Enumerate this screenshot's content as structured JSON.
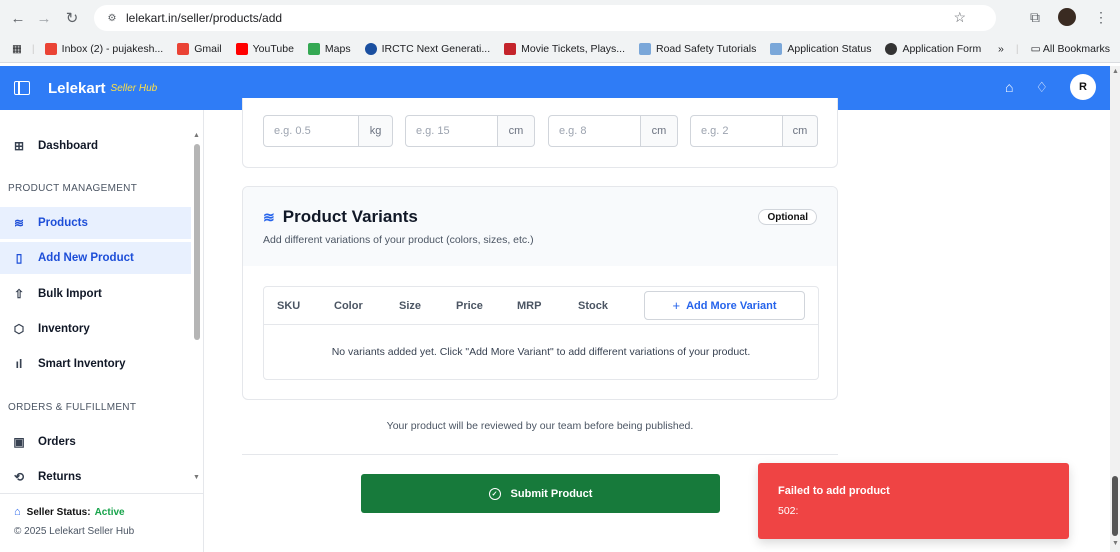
{
  "browser": {
    "url": "lelekart.in/seller/products/add",
    "bookmarks": [
      {
        "label": "Inbox (2) - pujakesh...",
        "icon": "gmail-icon",
        "color": "#ea4335"
      },
      {
        "label": "Gmail",
        "icon": "gmail-icon",
        "color": "#ea4335"
      },
      {
        "label": "YouTube",
        "icon": "youtube-icon",
        "color": "#ff0000"
      },
      {
        "label": "Maps",
        "icon": "maps-icon",
        "color": "#34a853"
      },
      {
        "label": "IRCTC Next Generati...",
        "icon": "irctc-icon",
        "color": "#1a4fa0"
      },
      {
        "label": "Movie Tickets, Plays...",
        "icon": "bookmyshow-icon",
        "color": "#c4242b"
      },
      {
        "label": "Road Safety Tutorials",
        "icon": "site-icon",
        "color": "#7aa7d9"
      },
      {
        "label": "Application Status",
        "icon": "site-icon",
        "color": "#7aa7d9"
      },
      {
        "label": "Application Form",
        "icon": "globe-icon",
        "color": "#333333"
      }
    ],
    "more_label": "»",
    "all_bookmarks": "All Bookmarks"
  },
  "header": {
    "brand": "Lelekart",
    "brand_sub": "Seller Hub",
    "user_initial": "R",
    "accent": "#2f7cf6"
  },
  "sidebar": {
    "dashboard": "Dashboard",
    "section_product": "PRODUCT MANAGEMENT",
    "products": "Products",
    "add_new_product": "Add New Product",
    "bulk_import": "Bulk Import",
    "inventory": "Inventory",
    "smart_inventory": "Smart Inventory",
    "section_orders": "ORDERS & FULFILLMENT",
    "orders": "Orders",
    "returns": "Returns",
    "status_label": "Seller Status:",
    "status_value": "Active",
    "copyright": "© 2025 Lelekart Seller Hub"
  },
  "dimensions": [
    {
      "placeholder": "e.g. 0.5",
      "unit": "kg"
    },
    {
      "placeholder": "e.g. 15",
      "unit": "cm"
    },
    {
      "placeholder": "e.g. 8",
      "unit": "cm"
    },
    {
      "placeholder": "e.g. 2",
      "unit": "cm"
    }
  ],
  "variants": {
    "title": "Product Variants",
    "subtitle": "Add different variations of your product (colors, sizes, etc.)",
    "badge": "Optional",
    "columns": [
      "SKU",
      "Color",
      "Size",
      "Price",
      "MRP",
      "Stock"
    ],
    "add_button": "Add More Variant",
    "empty_message": "No variants added yet. Click \"Add More Variant\" to add different variations of your product."
  },
  "review_note": "Your product will be reviewed by our team before being published.",
  "submit_label": "Submit Product",
  "toast": {
    "title": "Failed to add product",
    "message": "502:",
    "color": "#ef4444"
  }
}
